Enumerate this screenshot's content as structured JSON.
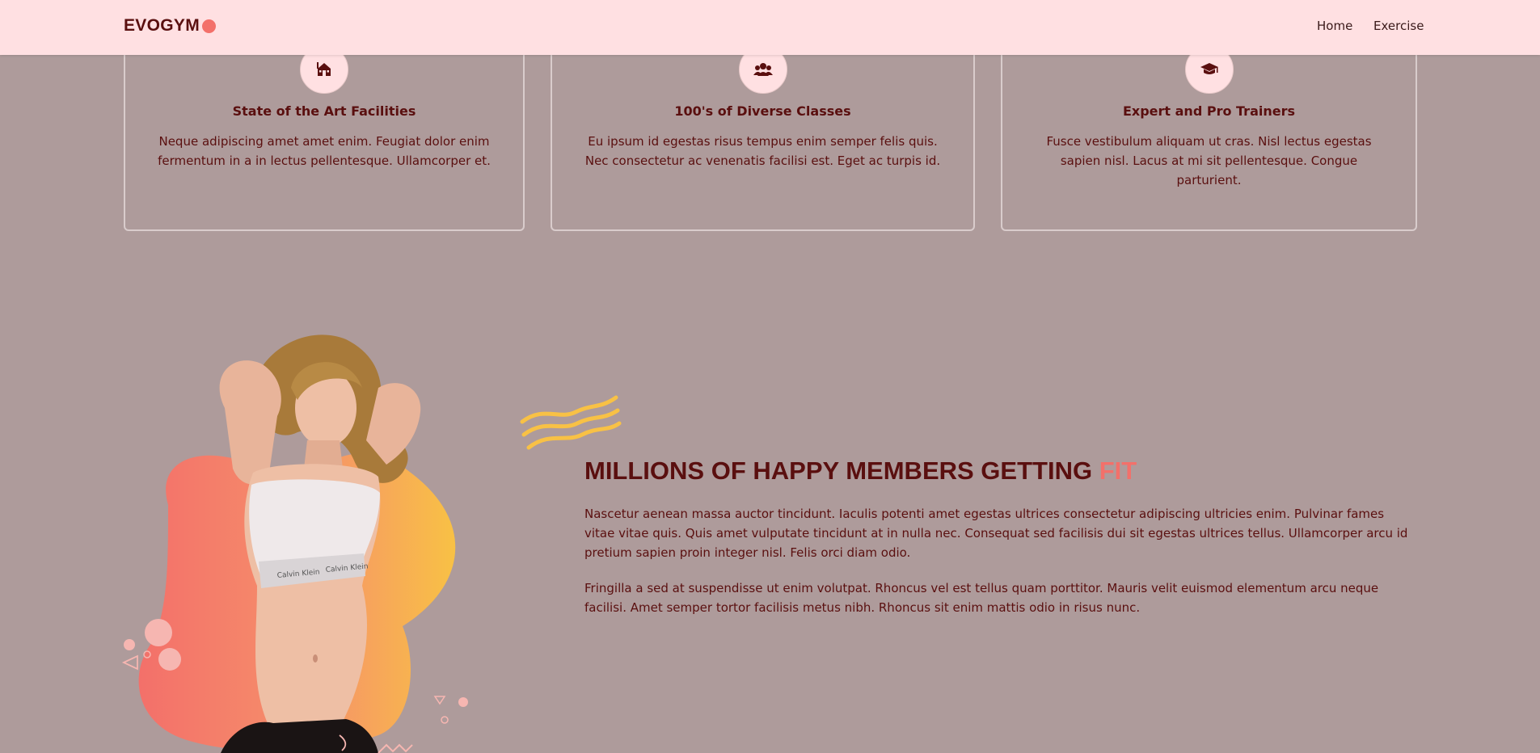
{
  "brand": {
    "name": "EVOGYM",
    "accent_color": "#f3706a"
  },
  "nav": {
    "links": [
      "Home",
      "Exercise"
    ]
  },
  "benefits": [
    {
      "icon": "home-icon",
      "title": "State of the Art Facilities",
      "text": "Neque adipiscing amet amet enim. Feugiat dolor enim fermentum in a in lectus pellentesque. Ullamcorper et."
    },
    {
      "icon": "user-group-icon",
      "title": "100's of Diverse Classes",
      "text": "Eu ipsum id egestas risus tempus enim semper felis quis. Nec consectetur ac venenatis facilisi est. Eget ac turpis id."
    },
    {
      "icon": "graduation-cap-icon",
      "title": "Expert and Pro Trainers",
      "text": "Fusce vestibulum aliquam ut cras. Nisl lectus egestas sapien nisl. Lacus at mi sit pellentesque. Congue parturient."
    }
  ],
  "members": {
    "title_main": "MILLIONS OF HAPPY MEMBERS GETTING",
    "title_accent": "FIT",
    "paragraphs": [
      "Nascetur aenean massa auctor tincidunt. Iaculis potenti amet egestas ultrices consectetur adipiscing ultricies enim. Pulvinar fames vitae vitae quis. Quis amet vulputate tincidunt at in nulla nec. Consequat sed facilisis dui sit egestas ultrices tellus. Ullamcorper arcu id pretium sapien proin integer nisl. Felis orci diam odio.",
      "Fringilla a sed at suspendisse ut enim volutpat. Rhoncus vel est tellus quam porttitor. Mauris velit euismod elementum arcu neque facilisi. Amet semper tortor facilisis metus nibh. Rhoncus sit enim mattis odio in risus nunc."
    ]
  },
  "colors": {
    "page_bg": "#ae9b9b",
    "navbar_bg": "#ffe0e2",
    "text_dark": "#5a0f0f",
    "accent": "#f3706a",
    "yellow": "#f8c145"
  }
}
